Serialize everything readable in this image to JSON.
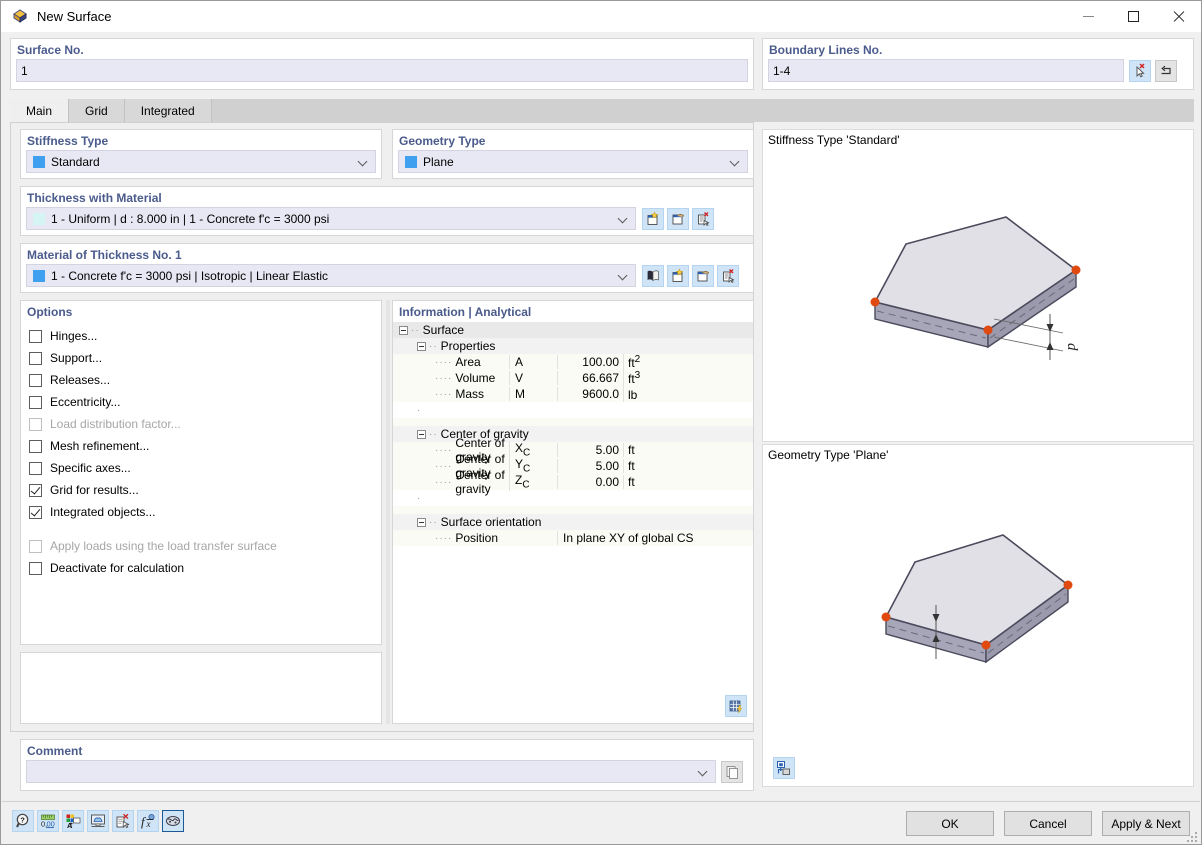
{
  "window": {
    "title": "New Surface",
    "icon": "surface-icon",
    "minimize": "minimize-icon",
    "maximize": "maximize-icon",
    "close": "close-icon"
  },
  "surface_no": {
    "label": "Surface No.",
    "value": "1"
  },
  "boundary_lines": {
    "label": "Boundary Lines No.",
    "value": "1-4",
    "pick_button": "pick-lines-icon",
    "reverse_button": "reverse-icon"
  },
  "tabs": [
    {
      "label": "Main",
      "active": true
    },
    {
      "label": "Grid",
      "active": false
    },
    {
      "label": "Integrated",
      "active": false
    }
  ],
  "stiffness_type": {
    "label": "Stiffness Type",
    "value": "Standard",
    "swatch": "#3fa0f0"
  },
  "geometry_type": {
    "label": "Geometry Type",
    "value": "Plane",
    "swatch": "#3fa0f0"
  },
  "thickness": {
    "label": "Thickness with Material",
    "value": "1 - Uniform | d : 8.000 in | 1 - Concrete f'c = 3000 psi",
    "swatch": "#d5f5f5",
    "buttons": [
      "new-thickness-icon",
      "edit-thickness-icon",
      "delete-thickness-icon"
    ]
  },
  "material": {
    "label": "Material of Thickness No. 1",
    "value": "1 - Concrete f'c = 3000 psi | Isotropic | Linear Elastic",
    "swatch": "#3fa0f0",
    "buttons": [
      "material-library-icon",
      "new-material-icon",
      "edit-material-icon",
      "delete-material-icon"
    ]
  },
  "options": {
    "label": "Options",
    "items": [
      {
        "label": "Hinges...",
        "checked": false,
        "disabled": false
      },
      {
        "label": "Support...",
        "checked": false,
        "disabled": false
      },
      {
        "label": "Releases...",
        "checked": false,
        "disabled": false
      },
      {
        "label": "Eccentricity...",
        "checked": false,
        "disabled": false
      },
      {
        "label": "Load distribution factor...",
        "checked": false,
        "disabled": true
      },
      {
        "label": "Mesh refinement...",
        "checked": false,
        "disabled": false
      },
      {
        "label": "Specific axes...",
        "checked": false,
        "disabled": false
      },
      {
        "label": "Grid for results...",
        "checked": true,
        "disabled": false
      },
      {
        "label": "Integrated objects...",
        "checked": true,
        "disabled": false
      }
    ],
    "items2": [
      {
        "label": "Apply loads using the load transfer surface",
        "checked": false,
        "disabled": true
      },
      {
        "label": "Deactivate for calculation",
        "checked": false,
        "disabled": false
      }
    ]
  },
  "information": {
    "header": "Information | Analytical",
    "root": "Surface",
    "groups": [
      {
        "name": "Properties",
        "rows": [
          {
            "name": "Area",
            "symbol": "A",
            "value": "100.00",
            "unit": "ft",
            "sup": "2"
          },
          {
            "name": "Volume",
            "symbol": "V",
            "value": "66.667",
            "unit": "ft",
            "sup": "3"
          },
          {
            "name": "Mass",
            "symbol": "M",
            "value": "9600.0",
            "unit": "lb",
            "sup": ""
          }
        ]
      },
      {
        "name": "Center of gravity",
        "rows": [
          {
            "name": "Center of gravity",
            "symbol": "X",
            "sub": "C",
            "value": "5.00",
            "unit": "ft",
            "sup": ""
          },
          {
            "name": "Center of gravity",
            "symbol": "Y",
            "sub": "C",
            "value": "5.00",
            "unit": "ft",
            "sup": ""
          },
          {
            "name": "Center of gravity",
            "symbol": "Z",
            "sub": "C",
            "value": "0.00",
            "unit": "ft",
            "sup": ""
          }
        ]
      },
      {
        "name": "Surface orientation",
        "wide_rows": [
          {
            "name": "Position",
            "text": "In plane XY of global CS"
          }
        ]
      }
    ],
    "table_button": "results-table-icon"
  },
  "comment": {
    "label": "Comment",
    "value": "",
    "copy_button": "copy-comment-icon"
  },
  "previews": [
    {
      "title": "Stiffness Type 'Standard'",
      "dim_label": "d",
      "graphic": "slab-iso-thickness"
    },
    {
      "title": "Geometry Type 'Plane'",
      "graphic": "slab-iso-plane",
      "button": "preview-settings-icon"
    }
  ],
  "bottom_toolbar": [
    "help-icon",
    "units-decimals-icon",
    "display-properties-icon",
    "visualization-icon",
    "clear-icon",
    "parameters-icon",
    "graphics-icon"
  ],
  "dialog_buttons": [
    {
      "label": "OK",
      "name": "ok-button"
    },
    {
      "label": "Cancel",
      "name": "cancel-button"
    },
    {
      "label": "Apply & Next",
      "name": "apply-next-button"
    }
  ]
}
